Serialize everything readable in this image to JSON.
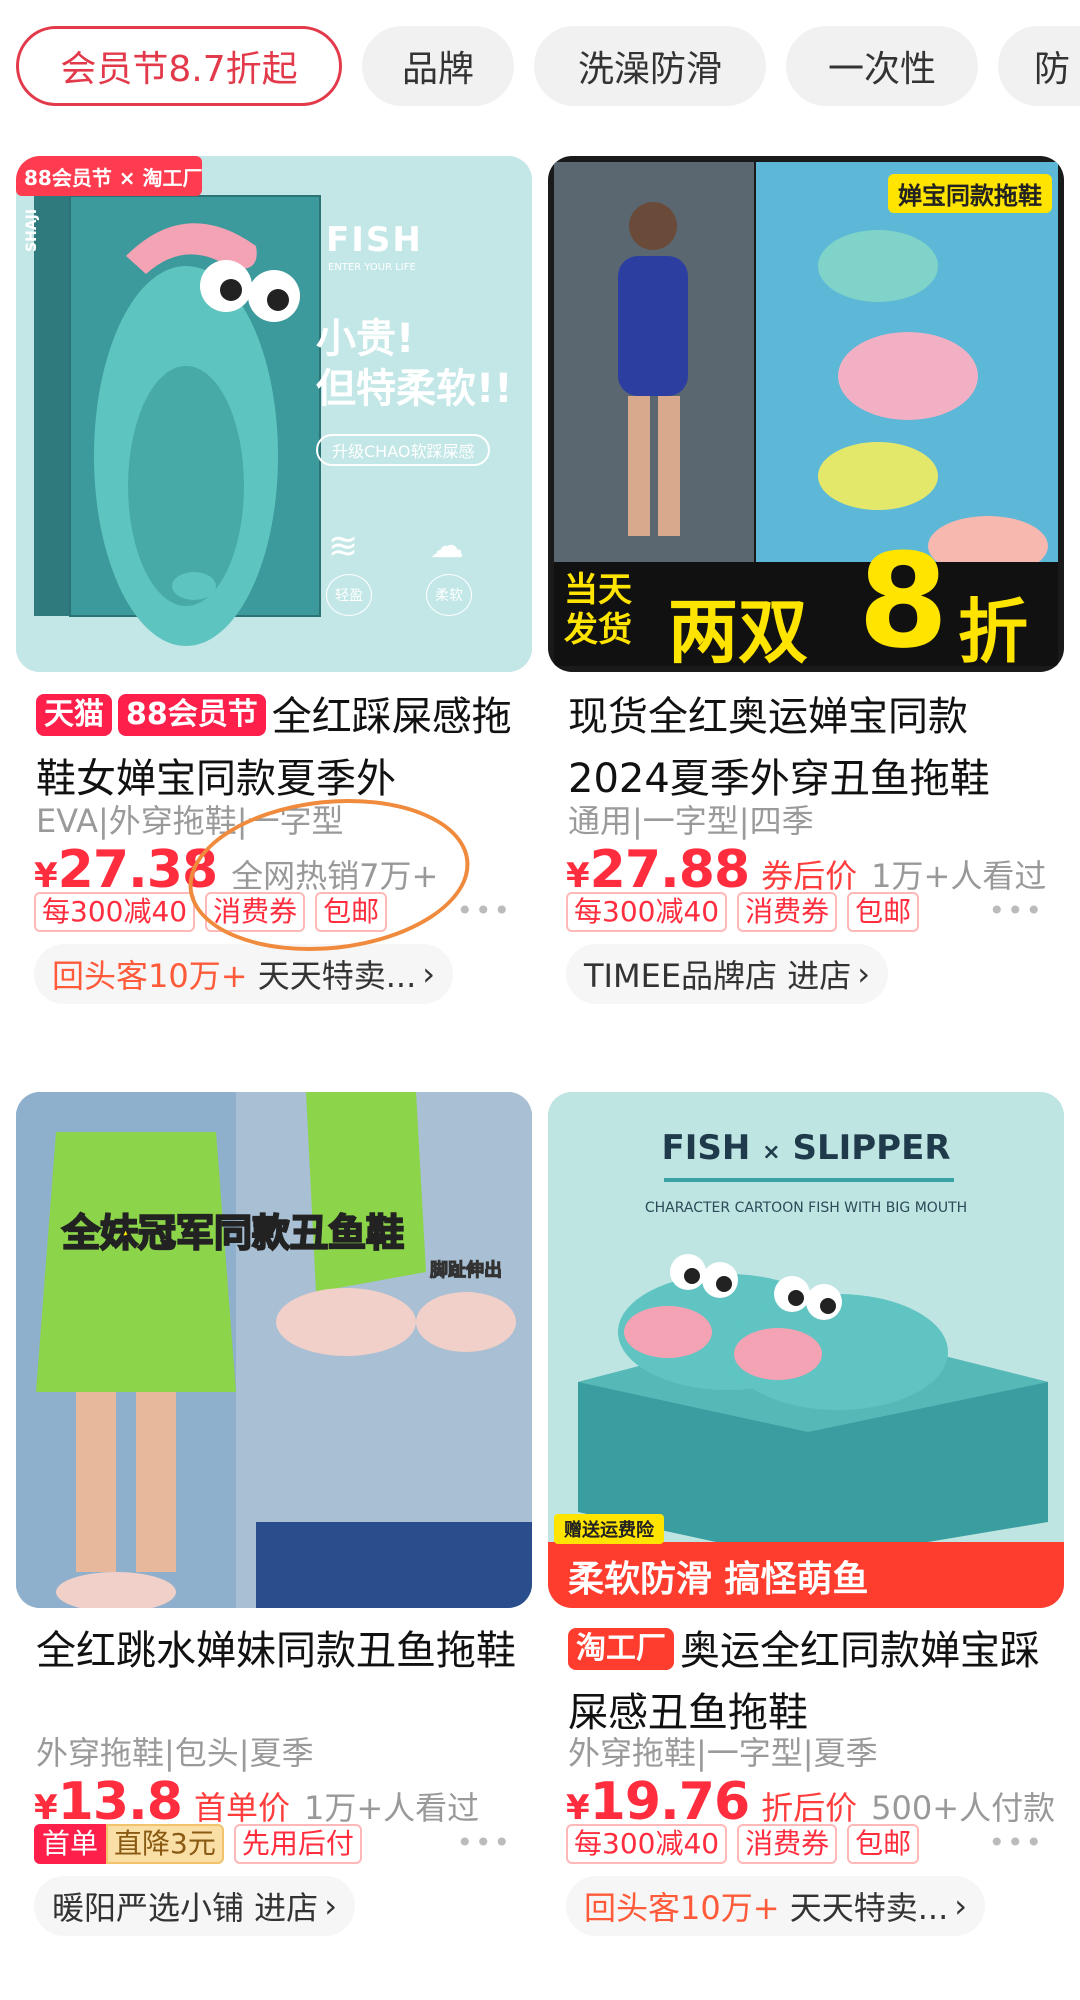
{
  "filters": [
    "会员节8.7折起",
    "品牌",
    "洗澡防滑",
    "一次性",
    "防"
  ],
  "products": [
    {
      "image": {
        "brand": "SHAJI",
        "box_title": "FISH",
        "box_sub": "ENTER YOUR LIFE",
        "line1": "小贵!",
        "line2": "但特柔软!!",
        "pill": "升级CHAO软踩屎感",
        "icon1": "轻盈",
        "icon2": "柔软",
        "corner": "88会员节 × 淘工厂"
      },
      "tags": [
        "天猫",
        "88会员节"
      ],
      "title": "全红踩屎感拖鞋女婵宝同款夏季外",
      "attrs": "EVA|外穿拖鞋|一字型",
      "yen": "¥",
      "price": "27.38",
      "price_label": "",
      "price_note": "全网热销7万+",
      "promos": [
        "每300减40",
        "消费券",
        "包邮"
      ],
      "store": {
        "highlight": "回头客10万+",
        "name": "天天特卖..."
      }
    },
    {
      "image": {
        "badge": "婵宝同款拖鞋",
        "banner_left": "当天\n发货",
        "banner_mid": "两双",
        "banner_num": "8",
        "banner_right": "折"
      },
      "tags": [],
      "title": "现货全红奥运婵宝同款2024夏季外穿丑鱼拖鞋",
      "attrs": "通用|一字型|四季",
      "yen": "¥",
      "price": "27.88",
      "price_label": "券后价",
      "price_note": "1万+人看过",
      "promos": [
        "每300减40",
        "消费券",
        "包邮"
      ],
      "store": {
        "highlight": "",
        "name": "TIMEE品牌店 进店"
      }
    },
    {
      "image": {
        "caption": "全妹冠军同款丑鱼鞋",
        "small": "脚趾伸出"
      },
      "tags": [],
      "title": "全红跳水婵妹同款丑鱼拖鞋",
      "attrs": "外穿拖鞋|包头|夏季",
      "yen": "¥",
      "price": "13.8",
      "price_label": "首单价",
      "price_note": "1万+人看过",
      "promos": [
        "首单",
        "直降3元",
        "先用后付"
      ],
      "store": {
        "highlight": "",
        "name": "暖阳严选小铺 进店"
      }
    },
    {
      "image": {
        "title1": "FISH",
        "title_x": "×",
        "title2": "SLIPPER",
        "sub": "CHARACTER CARTOON FISH WITH BIG MOUTH",
        "corner": "赠送运费险",
        "banner": "柔软防滑 搞怪萌鱼"
      },
      "tags": [
        "淘工厂"
      ],
      "title": "奥运全红同款婵宝踩屎感丑鱼拖鞋",
      "attrs": "外穿拖鞋|一字型|夏季",
      "yen": "¥",
      "price": "19.76",
      "price_label": "折后价",
      "price_note": "500+人付款",
      "promos": [
        "每300减40",
        "消费券",
        "包邮"
      ],
      "store": {
        "highlight": "回头客10万+",
        "name": "天天特卖..."
      }
    }
  ],
  "more_dots": "•••",
  "colors": {
    "accent": "#ff2d3e",
    "tmall": "#ff1f4b",
    "teal": "#6fc7c6"
  }
}
